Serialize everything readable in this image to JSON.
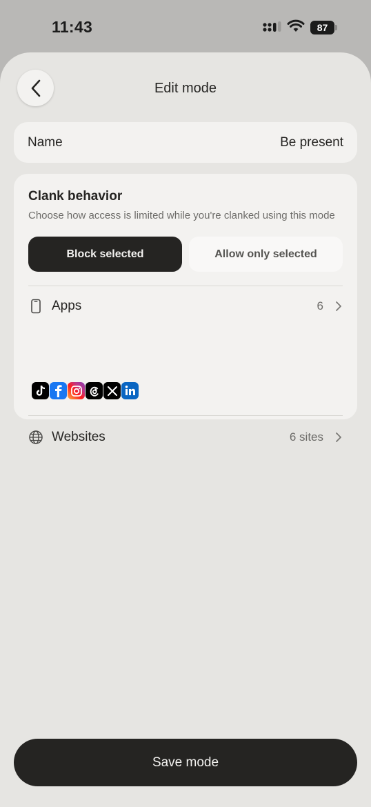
{
  "status_bar": {
    "time": "11:43",
    "battery_level": "87",
    "icons": [
      "signal-icon",
      "wifi-icon",
      "battery-icon"
    ]
  },
  "header": {
    "title": "Edit mode",
    "back_icon": "chevron-left-icon"
  },
  "name_field": {
    "label": "Name",
    "value": "Be present"
  },
  "behavior": {
    "title": "Clank behavior",
    "subtitle": "Choose how access is limited while you're clanked using this mode",
    "options": [
      {
        "label": "Block selected",
        "selected": true
      },
      {
        "label": "Allow only selected",
        "selected": false
      }
    ]
  },
  "apps_row": {
    "icon": "phone-icon",
    "label": "Apps",
    "count": "6",
    "app_icons": [
      "tiktok-icon",
      "facebook-icon",
      "instagram-icon",
      "threads-icon",
      "x-icon",
      "linkedin-icon"
    ]
  },
  "websites_row": {
    "icon": "globe-icon",
    "label": "Websites",
    "count": "6 sites"
  },
  "footer": {
    "save_label": "Save mode"
  },
  "colors": {
    "background": "#b9b8b6",
    "sheet": "#e6e5e2",
    "card": "#f3f2f0",
    "dark": "#252422",
    "muted": "#6d6c69"
  }
}
